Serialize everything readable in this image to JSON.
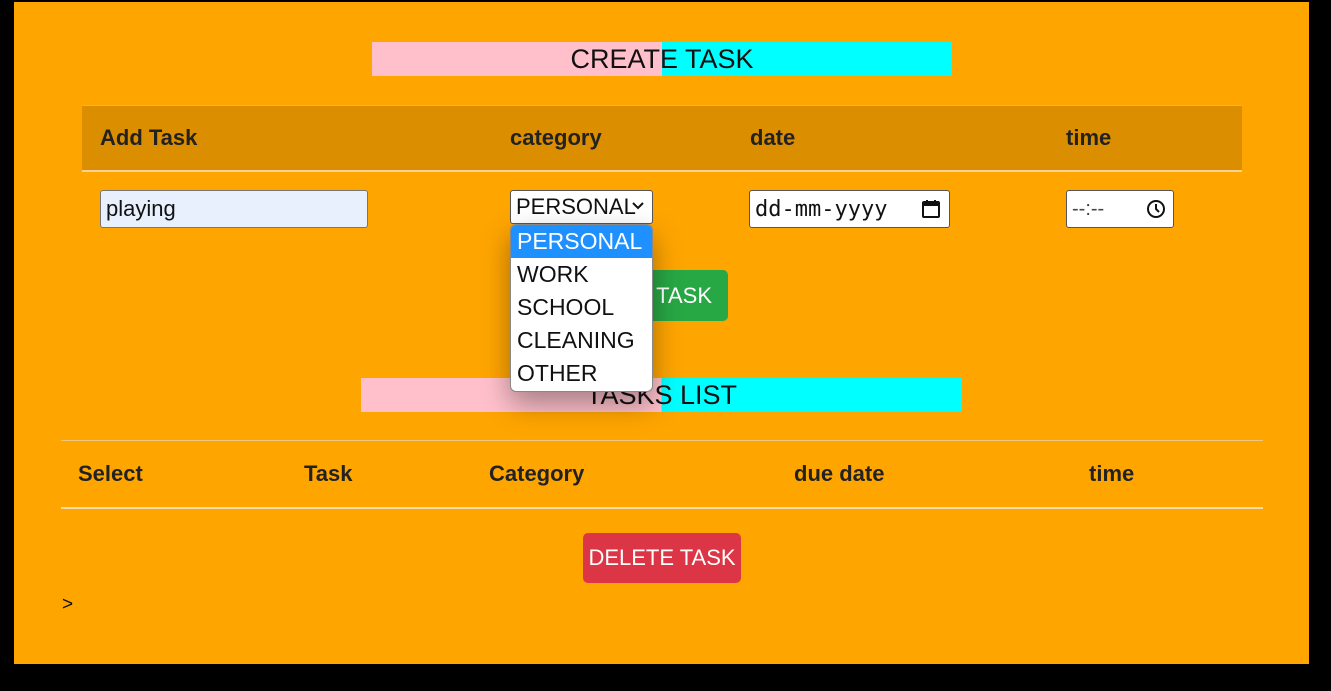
{
  "create": {
    "title": "CREATE TASK",
    "headers": {
      "task": "Add Task",
      "category": "category",
      "date": "date",
      "time": "time"
    },
    "task_value": "playing",
    "category_selected": "PERSONAL",
    "date_placeholder": "dd-mm-yyyy",
    "time_placeholder": "--:--",
    "add_button": "ADD TASK"
  },
  "dropdown": {
    "options": [
      "PERSONAL",
      "WORK",
      "SCHOOL",
      "CLEANING",
      "OTHER"
    ],
    "selected_index": 0
  },
  "list": {
    "title": "TASKS LIST",
    "headers": {
      "select": "Select",
      "task": "Task",
      "category": "Category",
      "due": "due date",
      "time": "time"
    },
    "delete_button": "DELETE TASK"
  },
  "prompt_text": ">",
  "colors": {
    "page_bg": "#ffa500",
    "header_bg": "#db8e00",
    "title_left": "#ffc0cb",
    "title_right": "#00ffff",
    "add_button": "#28a745",
    "delete_button": "#dc3545",
    "option_highlight": "#1e90ff"
  }
}
